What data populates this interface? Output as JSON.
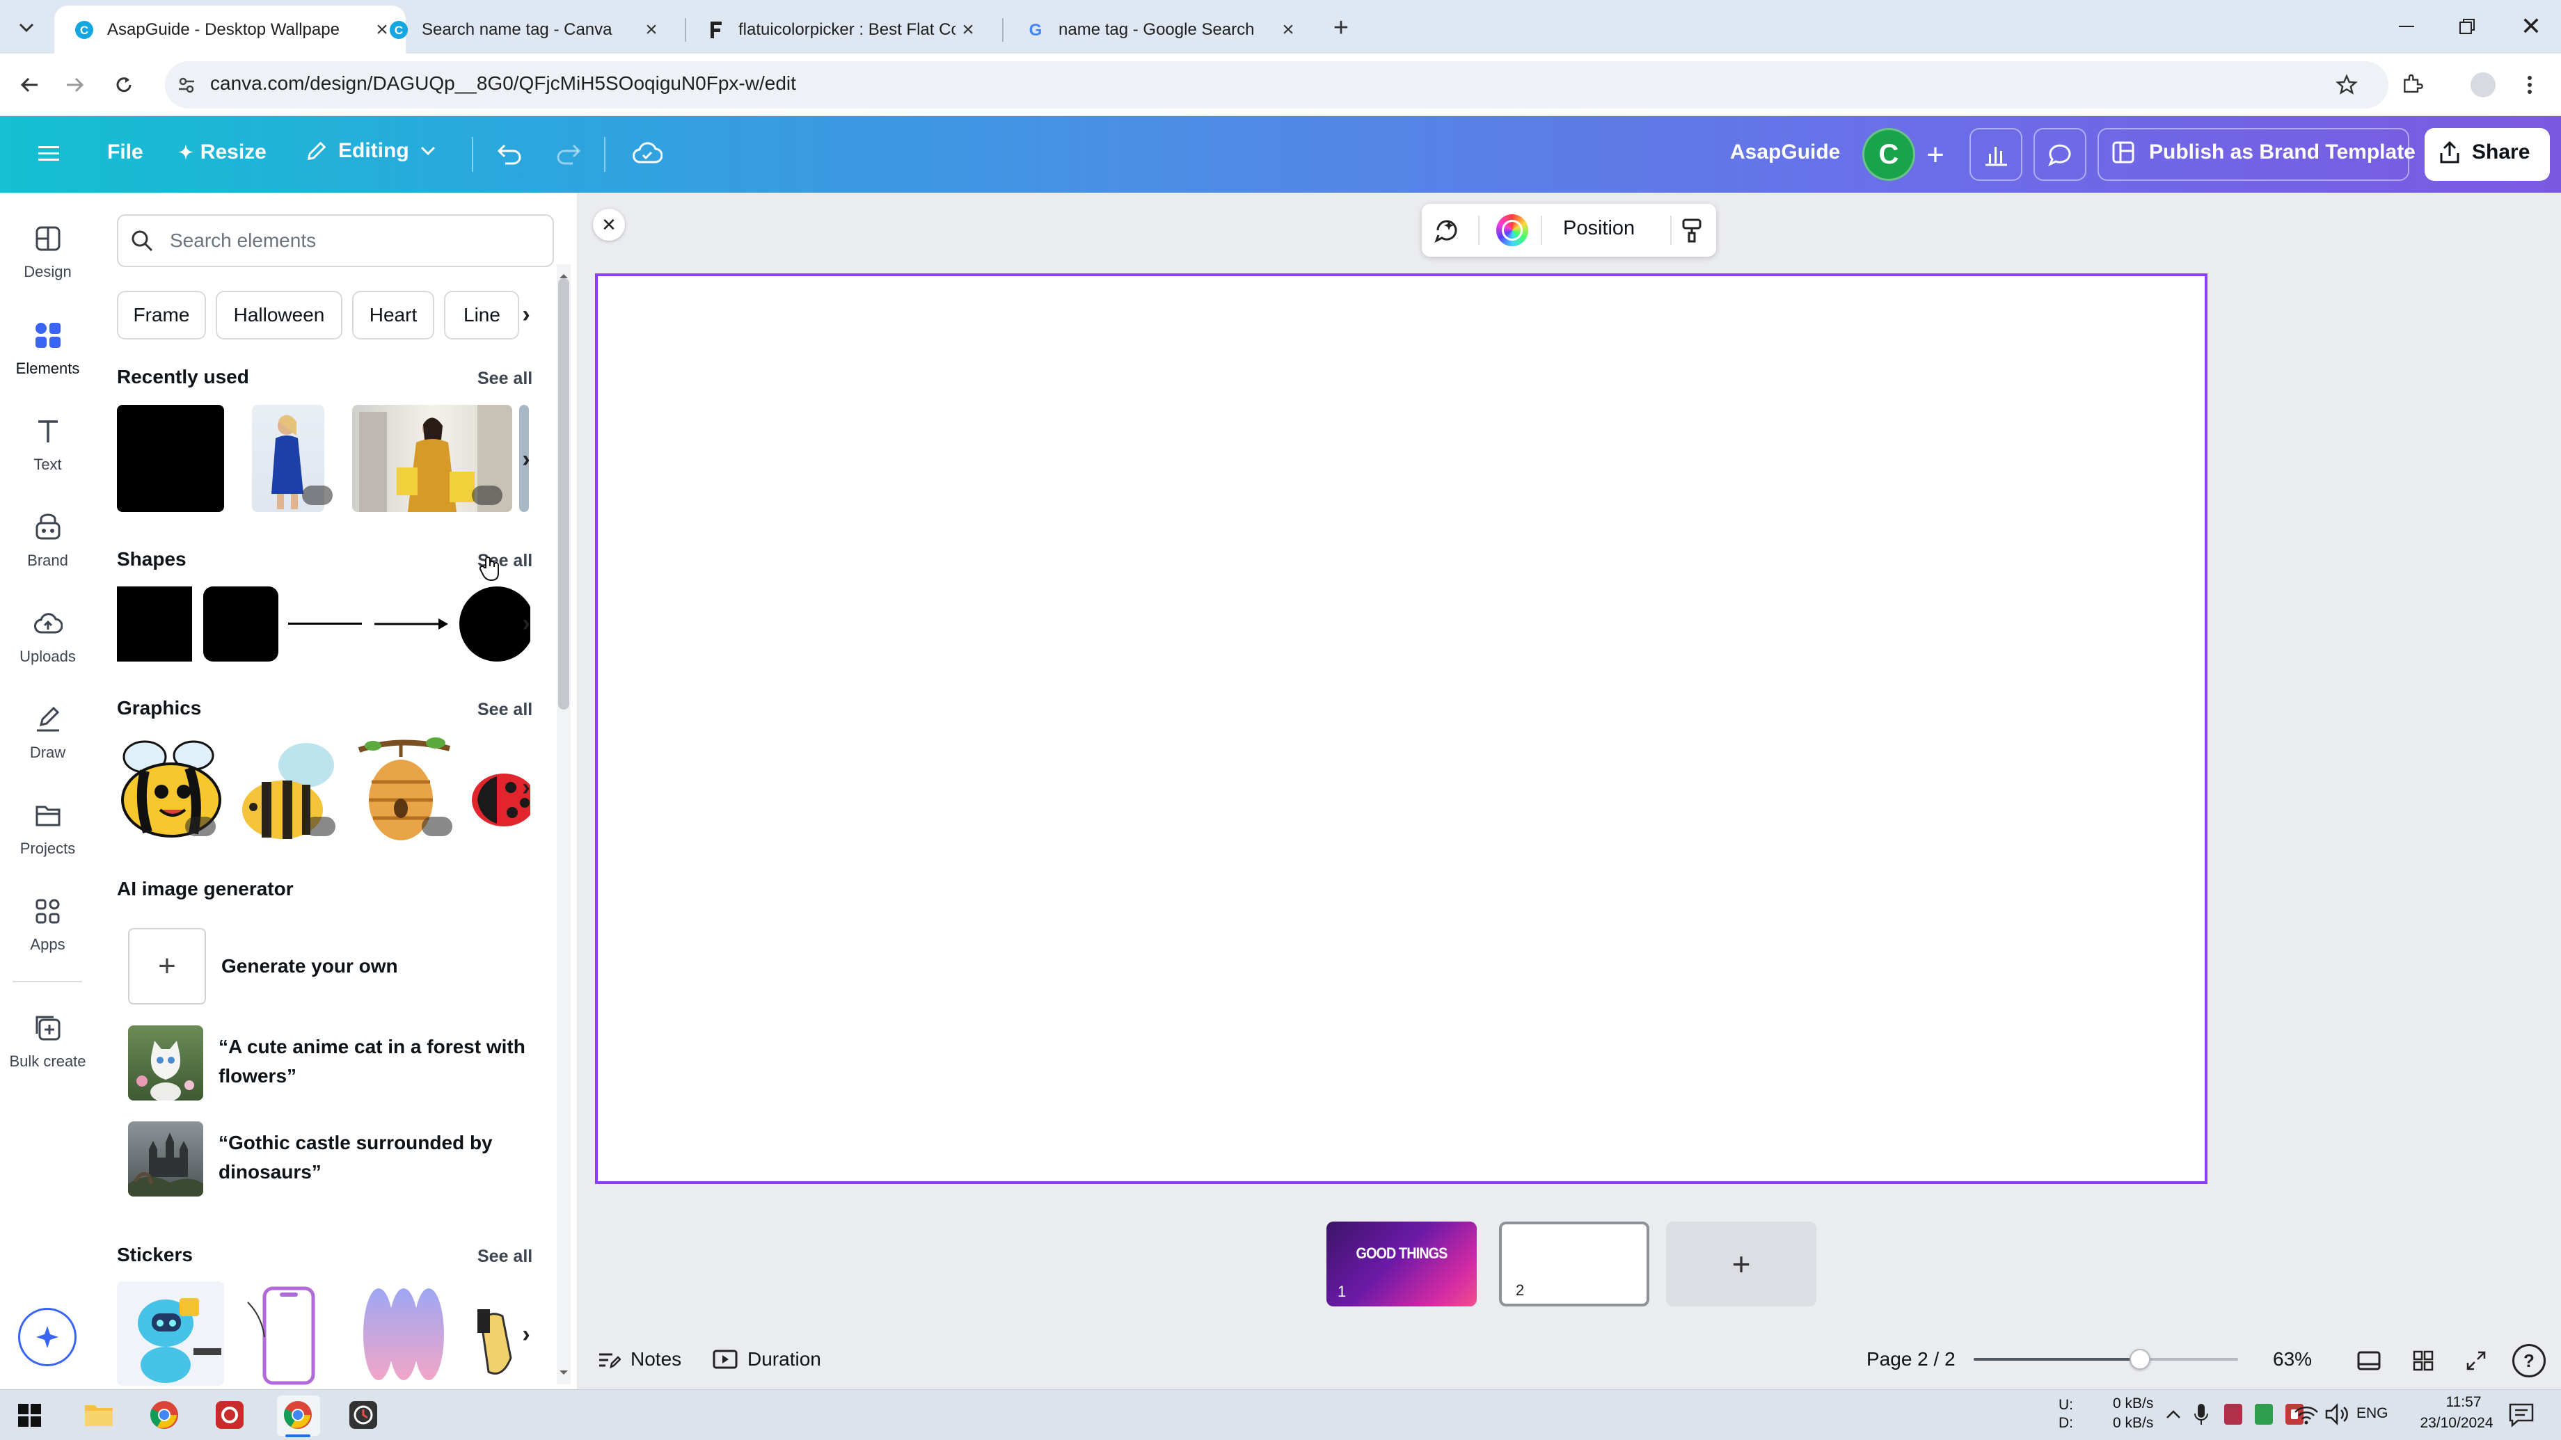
{
  "browser": {
    "tabs": [
      {
        "title": "AsapGuide - Desktop Wallpape",
        "active": true
      },
      {
        "title": "Search name tag - Canva",
        "active": false
      },
      {
        "title": "flatuicolorpicker : Best Flat Colo",
        "active": false
      },
      {
        "title": "name tag - Google Search",
        "active": false
      }
    ],
    "url": "canva.com/design/DAGUQp__8G0/QFjcMiH5SOoqiguN0Fpx-w/edit"
  },
  "header": {
    "file": "File",
    "resize": "Resize",
    "editing": "Editing",
    "team_name": "AsapGuide",
    "avatar_letter": "C",
    "publish": "Publish as Brand Template",
    "share": "Share"
  },
  "rail": [
    {
      "label": "Design",
      "icon": "design-icon"
    },
    {
      "label": "Elements",
      "icon": "elements-icon",
      "active": true
    },
    {
      "label": "Text",
      "icon": "text-icon"
    },
    {
      "label": "Brand",
      "icon": "brand-icon"
    },
    {
      "label": "Uploads",
      "icon": "uploads-icon"
    },
    {
      "label": "Draw",
      "icon": "draw-icon"
    },
    {
      "label": "Projects",
      "icon": "projects-icon"
    },
    {
      "label": "Apps",
      "icon": "apps-icon"
    },
    {
      "label": "Bulk create",
      "icon": "bulk-create-icon"
    }
  ],
  "panel": {
    "search_placeholder": "Search elements",
    "chips": [
      "Frame",
      "Halloween",
      "Heart",
      "Line"
    ],
    "recently_used": {
      "title": "Recently used",
      "see_all": "See all"
    },
    "shapes": {
      "title": "Shapes",
      "see_all": "See all"
    },
    "graphics": {
      "title": "Graphics",
      "see_all": "See all"
    },
    "ai": {
      "title": "AI image generator",
      "generate": "Generate your own",
      "prompt1": "“A cute anime cat in a forest with flowers”",
      "prompt2": "“Gothic castle surrounded by dinosaurs”"
    },
    "stickers": {
      "title": "Stickers",
      "see_all": "See all"
    }
  },
  "context_toolbar": {
    "position": "Position"
  },
  "pages": {
    "thumbs": [
      {
        "number": "1",
        "text": "GOOD THINGS"
      },
      {
        "number": "2",
        "text": ""
      }
    ]
  },
  "bottom": {
    "notes": "Notes",
    "duration": "Duration",
    "page_indicator": "Page 2 / 2",
    "zoom": "63%",
    "zoom_fraction": 0.63
  },
  "taskbar": {
    "net_up_label": "U:",
    "net_down_label": "D:",
    "net_up": "0 kB/s",
    "net_down": "0 kB/s",
    "lang": "ENG",
    "time": "11:57",
    "date": "23/10/2024"
  },
  "colors": {
    "accent": "#8b3dff",
    "header_start": "#14c0d2",
    "header_end": "#7a59e0",
    "avatar": "#19a44b"
  }
}
